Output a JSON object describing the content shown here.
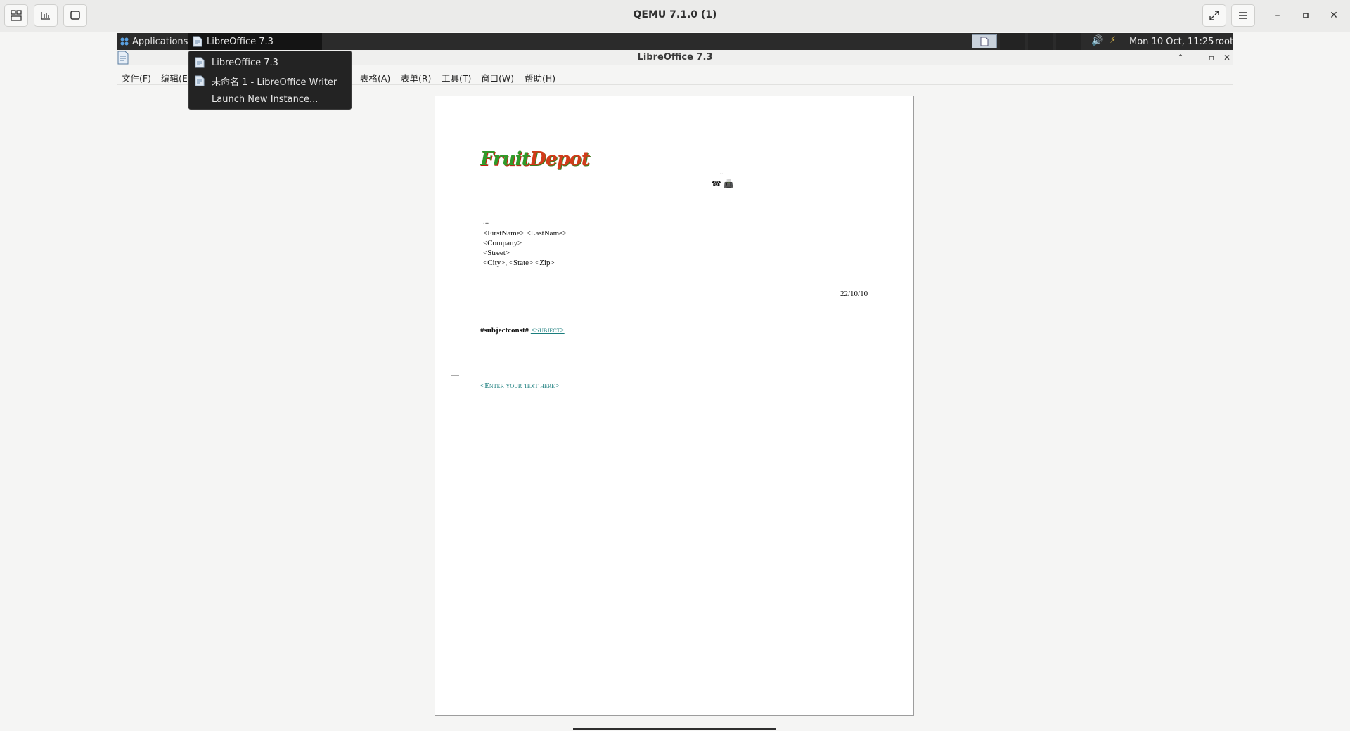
{
  "qemu": {
    "title": "QEMU 7.1.0 (1)"
  },
  "panel": {
    "applications_label": "Applications",
    "active_task_label": "LibreOffice 7.3",
    "clock": "Mon 10 Oct, 11:25",
    "user": "root"
  },
  "window": {
    "title": "LibreOffice 7.3"
  },
  "menu": {
    "items": [
      "文件(F)",
      "编辑(E)",
      "表格(A)",
      "表单(R)",
      "工具(T)",
      "窗口(W)",
      "帮助(H)"
    ]
  },
  "dropdown": {
    "items": [
      {
        "label": "LibreOffice 7.3",
        "icon": "document-icon"
      },
      {
        "label": "未命名 1 - LibreOffice Writer",
        "icon": "document-icon"
      },
      {
        "label": "Launch New Instance...",
        "icon": ""
      }
    ]
  },
  "document": {
    "logo_fruit": "Fruit",
    "logo_depot": "Depot",
    "dots": "..",
    "phone_fax": "☎ 📠",
    "ellipsis": "...",
    "address_lines": [
      "<FirstName> <LastName>",
      "<Company>",
      "<Street>",
      "<City>, <State> <Zip>"
    ],
    "date": "22/10/10",
    "subject_prefix": "#subjectconst#",
    "subject_field": "<Subject>",
    "body_field": "<Enter your text here>"
  },
  "colors": {
    "panel_bg": "#2b2b2b",
    "field_link": "#1a7d7d"
  }
}
